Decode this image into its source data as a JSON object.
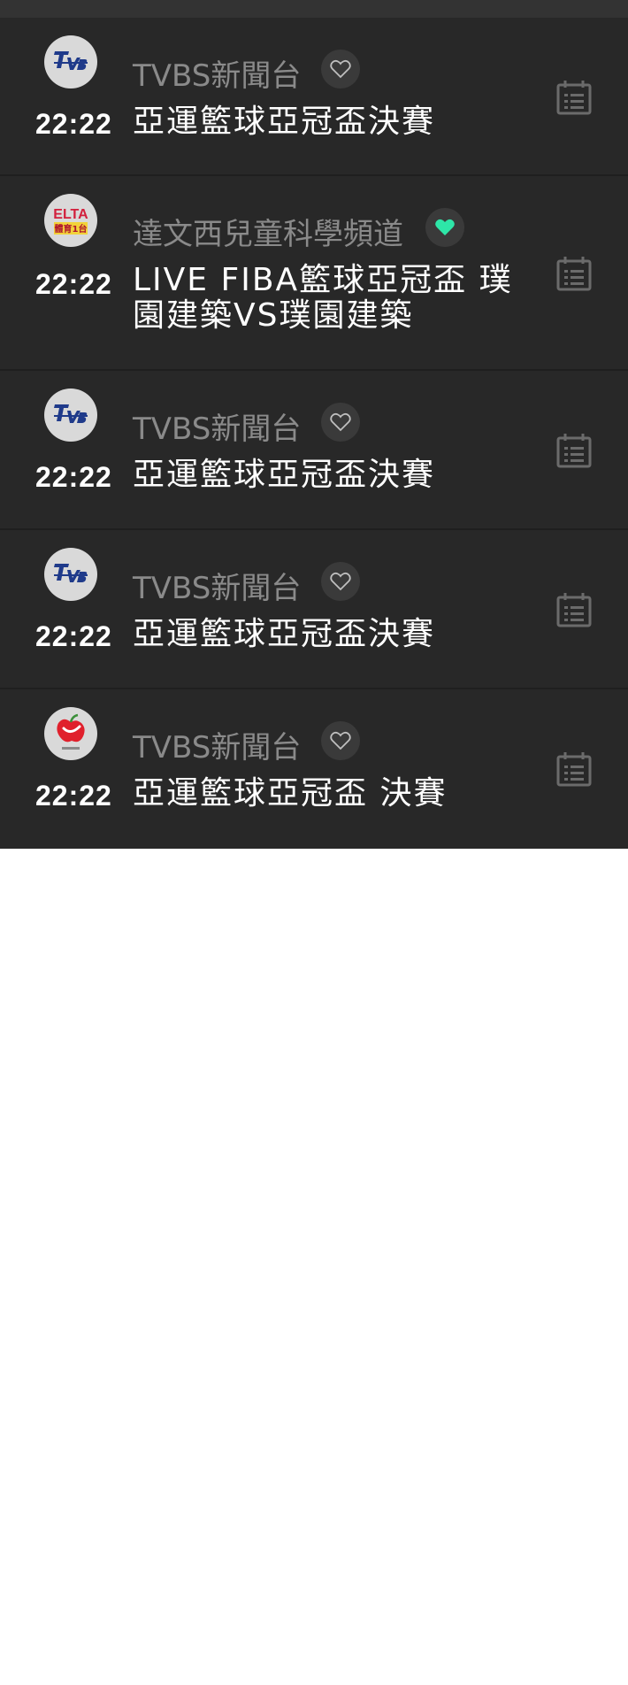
{
  "colors": {
    "background": "#282828",
    "row_divider": "#1f1f1f",
    "time_text": "#ffffff",
    "channel_text": "#8a8a8a",
    "title_text": "#ffffff",
    "favorite_active": "#2ee6a8",
    "icon_muted": "#6b6b6b"
  },
  "programs": [
    {
      "logo": "tvbs-logo",
      "channel": "TVBS新聞台",
      "favorite": false,
      "time": "22:22",
      "title": "亞運籃球亞冠盃決賽"
    },
    {
      "logo": "elta-sports-1-logo",
      "logo_text": [
        "ELTA",
        "體育1台"
      ],
      "channel": "達文西兒童科學頻道",
      "favorite": true,
      "time": "22:22",
      "title_lines": [
        "LIVE FIBA籃球亞冠盃 璞",
        "園建築VS璞園建築"
      ]
    },
    {
      "logo": "tvbs-logo",
      "channel": "TVBS新聞台",
      "favorite": false,
      "time": "22:22",
      "title": "亞運籃球亞冠盃決賽"
    },
    {
      "logo": "tvbs-logo",
      "channel": "TVBS新聞台",
      "favorite": false,
      "time": "22:22",
      "title": "亞運籃球亞冠盃決賽"
    },
    {
      "logo": "apple-channel-logo",
      "channel": "TVBS新聞台",
      "favorite": false,
      "time": "22:22",
      "title": "亞運籃球亞冠盃 決賽"
    }
  ]
}
